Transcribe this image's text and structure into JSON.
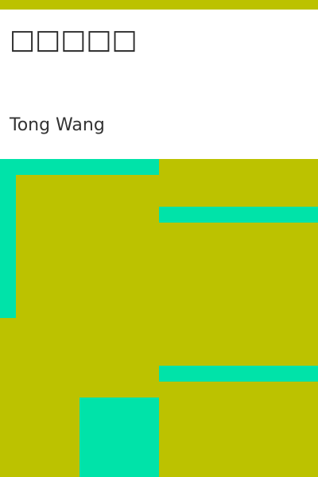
{
  "cover": {
    "title": "□□□□□",
    "author": "Tong Wang"
  },
  "colors": {
    "background": "#bcc200",
    "panel": "#ffffff",
    "accent": "#00e3a9",
    "title_text": "#2b2b2b",
    "author_text": "#333333"
  }
}
